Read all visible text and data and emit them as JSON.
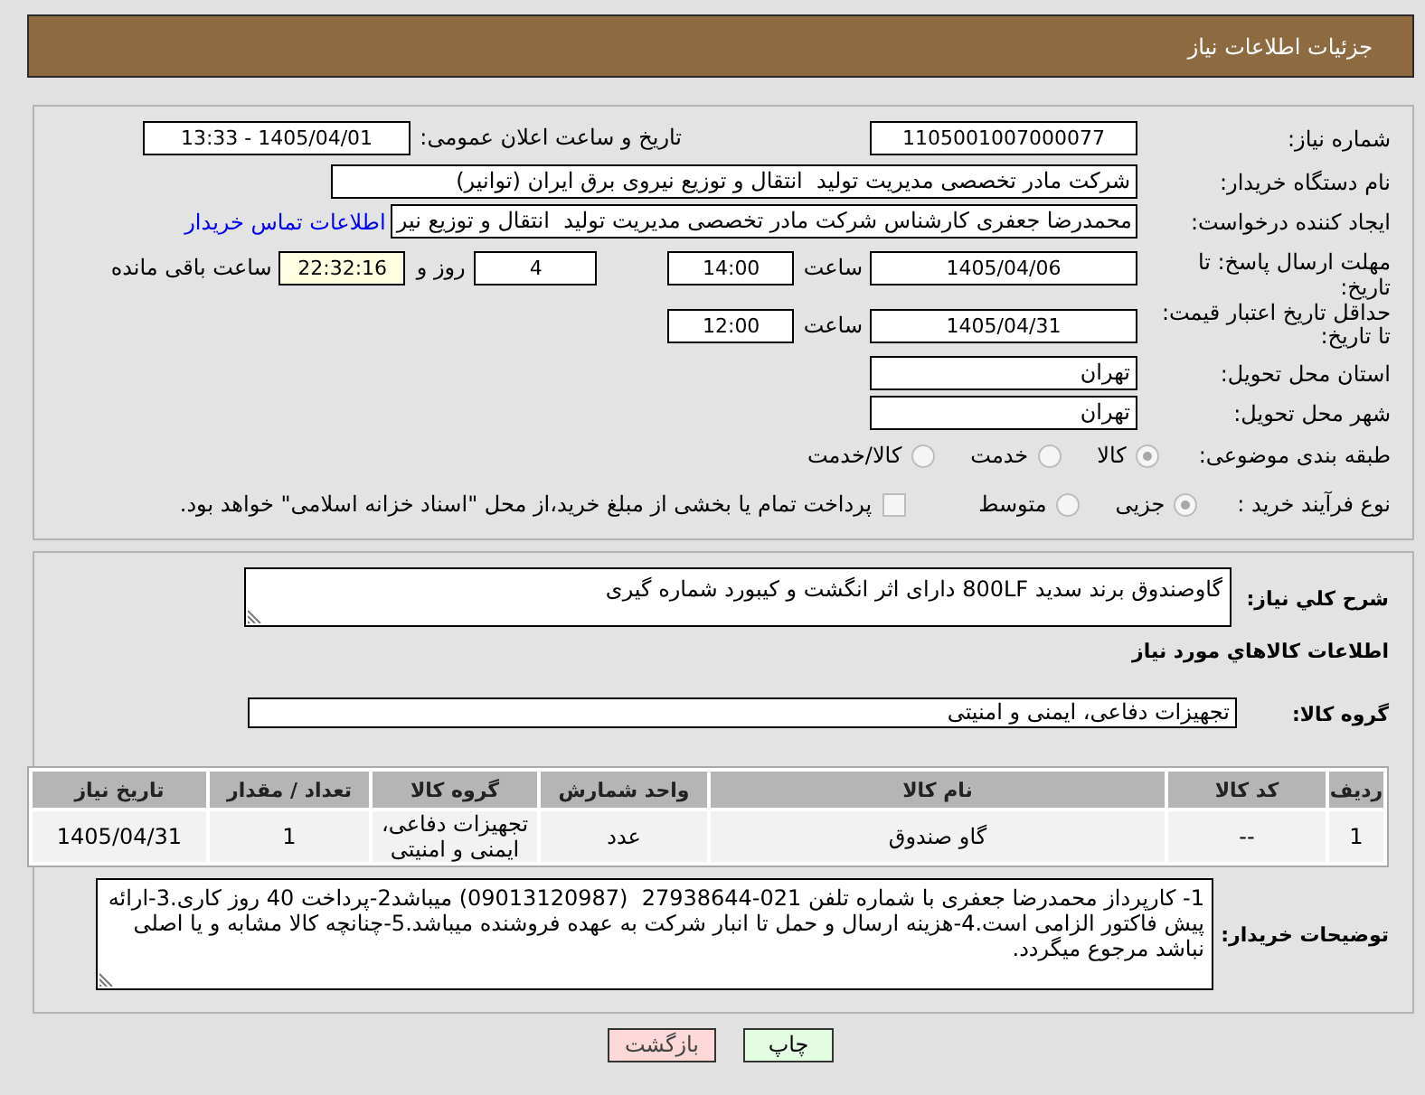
{
  "header": {
    "title": "جزئیات اطلاعات نیاز"
  },
  "need_number": {
    "label": "شماره نیاز:",
    "value": "1105001007000077"
  },
  "announcement": {
    "label": "تاریخ و ساعت اعلان عمومی:",
    "value": "1405/04/01 - 13:33"
  },
  "buyer_org": {
    "label": "نام دستگاه خریدار:",
    "value": "شرکت مادر تخصصی مدیریت تولید  انتقال و توزیع نیروی برق ایران (توانیر)"
  },
  "requester": {
    "label": "ایجاد کننده درخواست:",
    "value": "محمدرضا جعفری کارشناس شرکت مادر تخصصی مدیریت تولید  انتقال و توزیع نیر",
    "link": "اطلاعات تماس خریدار"
  },
  "reply_deadline": {
    "label": "مهلت ارسال پاسخ: تا تاریخ:",
    "date": "1405/04/06",
    "time_label": "ساعت",
    "time": "14:00",
    "days": "4",
    "days_label": "روز و",
    "remaining": "22:32:16",
    "remaining_label": "ساعت باقی مانده"
  },
  "price_validity": {
    "label": "حداقل تاریخ اعتبار قیمت: تا تاریخ:",
    "date": "1405/04/31",
    "time_label": "ساعت",
    "time": "12:00"
  },
  "delivery_province": {
    "label": "استان محل تحویل:",
    "value": "تهران"
  },
  "delivery_city": {
    "label": "شهر محل تحویل:",
    "value": "تهران"
  },
  "subject_category": {
    "label": "طبقه بندی موضوعی:",
    "options": [
      {
        "label": "کالا",
        "selected": true,
        "disabled": true
      },
      {
        "label": "خدمت",
        "selected": false,
        "disabled": true
      },
      {
        "label": "کالا/خدمت",
        "selected": false,
        "disabled": true
      }
    ]
  },
  "purchase_process": {
    "label": "نوع فرآیند خرید :",
    "options": [
      {
        "label": "جزیی",
        "selected": true,
        "disabled": true
      },
      {
        "label": "متوسط",
        "selected": false,
        "disabled": true
      }
    ],
    "treasury_payment": {
      "label": "پرداخت تمام یا بخشی از مبلغ خرید،از محل \"اسناد خزانه اسلامی\" خواهد بود.",
      "checked": false,
      "disabled": true
    }
  },
  "need_description": {
    "label": "شرح کلي نیاز:",
    "value": "گاوصندوق برند سدید 800LF دارای اثر انگشت و کیبورد شماره گیری"
  },
  "items_heading": "اطلاعات کالاهاي مورد نیاز",
  "goods_group": {
    "label": "گروه کالا:",
    "value": "تجهیزات دفاعی، ایمنی و امنیتی"
  },
  "items_table": {
    "columns": [
      "ردیف",
      "کد کالا",
      "نام کالا",
      "واحد شمارش",
      "گروه کالا",
      "تعداد / مقدار",
      "تاریخ نیاز"
    ],
    "rows": [
      [
        "1",
        "--",
        "گاو صندوق",
        "عدد",
        "تجهیزات دفاعی، ایمنی و امنیتی",
        "1",
        "1405/04/31"
      ]
    ]
  },
  "buyer_notes": {
    "label": "توضیحات خریدار:",
    "value": "1- کارپرداز محمدرضا جعفری با شماره تلفن 021-27938644  (09013120987) میباشد2-پرداخت 40 روز کاری.3-ارائه پیش فاکتور الزامی است.4-هزینه ارسال و حمل تا انبار شرکت به عهده فروشنده میباشد.5-چنانچه کالا مشابه و یا اصلی نباشد مرجوع میگردد."
  },
  "buttons": [
    {
      "label": "چاپ",
      "kind": "print"
    },
    {
      "label": "بازگشت",
      "kind": "back"
    }
  ]
}
